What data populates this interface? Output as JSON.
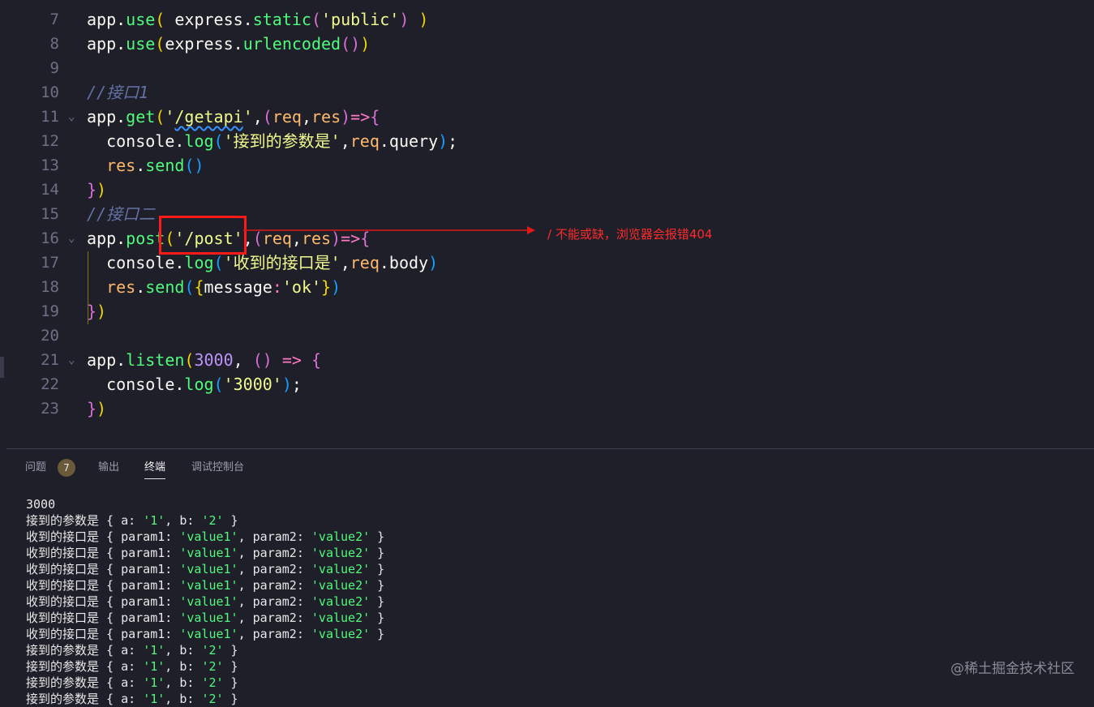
{
  "editor": {
    "lines": [
      {
        "num": "7",
        "fold": "",
        "tokens": [
          [
            "app",
            "t-pl"
          ],
          [
            ".",
            "t-p"
          ],
          [
            "use",
            "t-fn"
          ],
          [
            "(",
            "t-b1"
          ],
          [
            " express",
            "t-pl"
          ],
          [
            ".",
            "t-p"
          ],
          [
            "static",
            "t-fn"
          ],
          [
            "(",
            "t-b2"
          ],
          [
            "'public'",
            "t-str"
          ],
          [
            ")",
            "t-b2"
          ],
          [
            " )",
            "t-b1"
          ]
        ]
      },
      {
        "num": "8",
        "fold": "",
        "tokens": [
          [
            "app",
            "t-pl"
          ],
          [
            ".",
            "t-p"
          ],
          [
            "use",
            "t-fn"
          ],
          [
            "(",
            "t-b1"
          ],
          [
            "express",
            "t-pl"
          ],
          [
            ".",
            "t-p"
          ],
          [
            "urlencoded",
            "t-fn"
          ],
          [
            "(",
            "t-b2"
          ],
          [
            ")",
            "t-b2"
          ],
          [
            ")",
            "t-b1"
          ]
        ]
      },
      {
        "num": "9",
        "fold": "",
        "tokens": []
      },
      {
        "num": "10",
        "fold": "",
        "tokens": [
          [
            "//接口1",
            "t-com"
          ]
        ]
      },
      {
        "num": "11",
        "fold": "⌄",
        "tokens": [
          [
            "app",
            "t-pl"
          ],
          [
            ".",
            "t-p"
          ],
          [
            "get",
            "t-fn"
          ],
          [
            "(",
            "t-b1"
          ],
          [
            "'",
            "t-str"
          ],
          [
            "/getapi",
            "t-str wavy"
          ],
          [
            "'",
            "t-str"
          ],
          [
            ",",
            "t-p"
          ],
          [
            "(",
            "t-b2"
          ],
          [
            "req",
            "t-par"
          ],
          [
            ",",
            "t-p"
          ],
          [
            "res",
            "t-par"
          ],
          [
            ")",
            "t-b2"
          ],
          [
            "=>",
            "t-kw"
          ],
          [
            "{",
            "t-b2"
          ]
        ]
      },
      {
        "num": "12",
        "fold": "",
        "tokens": [
          [
            "  console",
            "t-pl"
          ],
          [
            ".",
            "t-p"
          ],
          [
            "log",
            "t-fn"
          ],
          [
            "(",
            "t-b3"
          ],
          [
            "'接到的参数是'",
            "t-str"
          ],
          [
            ",",
            "t-p"
          ],
          [
            "req",
            "t-par"
          ],
          [
            ".",
            "t-p"
          ],
          [
            "query",
            "t-pl"
          ],
          [
            ")",
            "t-b3"
          ],
          [
            ";",
            "t-p"
          ]
        ]
      },
      {
        "num": "13",
        "fold": "",
        "tokens": [
          [
            "  res",
            "t-par"
          ],
          [
            ".",
            "t-p"
          ],
          [
            "send",
            "t-fn"
          ],
          [
            "(",
            "t-b3"
          ],
          [
            ")",
            "t-b3"
          ]
        ]
      },
      {
        "num": "14",
        "fold": "",
        "tokens": [
          [
            "}",
            "t-b2"
          ],
          [
            ")",
            "t-b1"
          ]
        ]
      },
      {
        "num": "15",
        "fold": "",
        "tokens": [
          [
            "//接口二",
            "t-com"
          ]
        ]
      },
      {
        "num": "16",
        "fold": "⌄",
        "tokens": [
          [
            "app",
            "t-pl"
          ],
          [
            ".",
            "t-p"
          ],
          [
            "post",
            "t-fn"
          ],
          [
            "(",
            "t-b1"
          ],
          [
            "'/post'",
            "t-str"
          ],
          [
            ",",
            "t-p"
          ],
          [
            "(",
            "t-b2"
          ],
          [
            "req",
            "t-par"
          ],
          [
            ",",
            "t-p"
          ],
          [
            "res",
            "t-par"
          ],
          [
            ")",
            "t-b2"
          ],
          [
            "=>",
            "t-kw"
          ],
          [
            "{",
            "t-b2"
          ]
        ]
      },
      {
        "num": "17",
        "fold": "",
        "tokens": [
          [
            "  console",
            "t-pl"
          ],
          [
            ".",
            "t-p"
          ],
          [
            "log",
            "t-fn"
          ],
          [
            "(",
            "t-b3"
          ],
          [
            "'收到的接口是'",
            "t-str"
          ],
          [
            ",",
            "t-p"
          ],
          [
            "req",
            "t-par"
          ],
          [
            ".",
            "t-p"
          ],
          [
            "body",
            "t-pl"
          ],
          [
            ")",
            "t-b3"
          ]
        ]
      },
      {
        "num": "18",
        "fold": "",
        "tokens": [
          [
            "  res",
            "t-par"
          ],
          [
            ".",
            "t-p"
          ],
          [
            "send",
            "t-fn"
          ],
          [
            "(",
            "t-b3"
          ],
          [
            "{",
            "t-b1"
          ],
          [
            "message",
            "t-pl"
          ],
          [
            ":",
            "t-kw"
          ],
          [
            "'ok'",
            "t-str"
          ],
          [
            "}",
            "t-b1"
          ],
          [
            ")",
            "t-b3"
          ]
        ]
      },
      {
        "num": "19",
        "fold": "",
        "tokens": [
          [
            "}",
            "t-b2"
          ],
          [
            ")",
            "t-b1"
          ]
        ]
      },
      {
        "num": "20",
        "fold": "",
        "tokens": []
      },
      {
        "num": "21",
        "fold": "⌄",
        "tokens": [
          [
            "app",
            "t-pl"
          ],
          [
            ".",
            "t-p"
          ],
          [
            "listen",
            "t-fn"
          ],
          [
            "(",
            "t-b1"
          ],
          [
            "3000",
            "t-num"
          ],
          [
            ", ",
            "t-p"
          ],
          [
            "(",
            "t-b2"
          ],
          [
            ")",
            "t-b2"
          ],
          [
            " => ",
            "t-kw"
          ],
          [
            "{",
            "t-b2"
          ]
        ]
      },
      {
        "num": "22",
        "fold": "",
        "tokens": [
          [
            "  console",
            "t-pl"
          ],
          [
            ".",
            "t-p"
          ],
          [
            "log",
            "t-fn"
          ],
          [
            "(",
            "t-b3"
          ],
          [
            "'3000'",
            "t-str"
          ],
          [
            ")",
            "t-b3"
          ],
          [
            ";",
            "t-p"
          ]
        ]
      },
      {
        "num": "23",
        "fold": "",
        "tokens": [
          [
            "}",
            "t-b2"
          ],
          [
            ")",
            "t-b1"
          ]
        ]
      }
    ],
    "annotation": "/ 不能或缺，浏览器会报错404"
  },
  "panel": {
    "tabs": [
      {
        "label": "问题",
        "active": false
      },
      {
        "label": "输出",
        "active": false
      },
      {
        "label": "终端",
        "active": true
      },
      {
        "label": "调试控制台",
        "active": false
      }
    ],
    "problems_count": "7"
  },
  "terminal": {
    "lines": [
      [
        [
          "3000",
          ""
        ]
      ],
      [
        [
          "接到的参数是 { a: ",
          ""
        ],
        [
          "'1'",
          "tstr"
        ],
        [
          ", b: ",
          ""
        ],
        [
          "'2'",
          "tstr"
        ],
        [
          " }",
          ""
        ]
      ],
      [
        [
          "收到的接口是 { param1: ",
          ""
        ],
        [
          "'value1'",
          "tstr"
        ],
        [
          ", param2: ",
          ""
        ],
        [
          "'value2'",
          "tstr"
        ],
        [
          " }",
          ""
        ]
      ],
      [
        [
          "收到的接口是 { param1: ",
          ""
        ],
        [
          "'value1'",
          "tstr"
        ],
        [
          ", param2: ",
          ""
        ],
        [
          "'value2'",
          "tstr"
        ],
        [
          " }",
          ""
        ]
      ],
      [
        [
          "收到的接口是 { param1: ",
          ""
        ],
        [
          "'value1'",
          "tstr"
        ],
        [
          ", param2: ",
          ""
        ],
        [
          "'value2'",
          "tstr"
        ],
        [
          " }",
          ""
        ]
      ],
      [
        [
          "收到的接口是 { param1: ",
          ""
        ],
        [
          "'value1'",
          "tstr"
        ],
        [
          ", param2: ",
          ""
        ],
        [
          "'value2'",
          "tstr"
        ],
        [
          " }",
          ""
        ]
      ],
      [
        [
          "收到的接口是 { param1: ",
          ""
        ],
        [
          "'value1'",
          "tstr"
        ],
        [
          ", param2: ",
          ""
        ],
        [
          "'value2'",
          "tstr"
        ],
        [
          " }",
          ""
        ]
      ],
      [
        [
          "收到的接口是 { param1: ",
          ""
        ],
        [
          "'value1'",
          "tstr"
        ],
        [
          ", param2: ",
          ""
        ],
        [
          "'value2'",
          "tstr"
        ],
        [
          " }",
          ""
        ]
      ],
      [
        [
          "收到的接口是 { param1: ",
          ""
        ],
        [
          "'value1'",
          "tstr"
        ],
        [
          ", param2: ",
          ""
        ],
        [
          "'value2'",
          "tstr"
        ],
        [
          " }",
          ""
        ]
      ],
      [
        [
          "接到的参数是 { a: ",
          ""
        ],
        [
          "'1'",
          "tstr"
        ],
        [
          ", b: ",
          ""
        ],
        [
          "'2'",
          "tstr"
        ],
        [
          " }",
          ""
        ]
      ],
      [
        [
          "接到的参数是 { a: ",
          ""
        ],
        [
          "'1'",
          "tstr"
        ],
        [
          ", b: ",
          ""
        ],
        [
          "'2'",
          "tstr"
        ],
        [
          " }",
          ""
        ]
      ],
      [
        [
          "接到的参数是 { a: ",
          ""
        ],
        [
          "'1'",
          "tstr"
        ],
        [
          ", b: ",
          ""
        ],
        [
          "'2'",
          "tstr"
        ],
        [
          " }",
          ""
        ]
      ],
      [
        [
          "接到的参数是 { a: ",
          ""
        ],
        [
          "'1'",
          "tstr"
        ],
        [
          ", b: ",
          ""
        ],
        [
          "'2'",
          "tstr"
        ],
        [
          " }",
          ""
        ]
      ]
    ]
  },
  "watermark": "@稀土掘金技术社区"
}
